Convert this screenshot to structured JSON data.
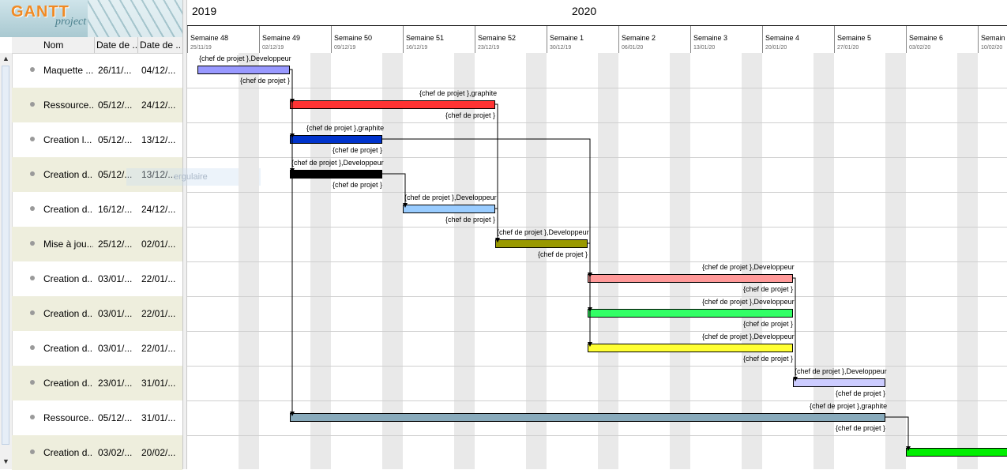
{
  "app": {
    "logo_main": "GANTT",
    "logo_sub": "project"
  },
  "columns": [
    "Nom",
    "Date de ...",
    "Date de ..."
  ],
  "tasks": [
    {
      "name": "Maquette ...",
      "start": "26/11/...",
      "end": "04/12/..."
    },
    {
      "name": "Ressource...",
      "start": "05/12/...",
      "end": "24/12/..."
    },
    {
      "name": "Creation l...",
      "start": "05/12/...",
      "end": "13/12/..."
    },
    {
      "name": "Creation d...",
      "start": "05/12/...",
      "end": "13/12/..."
    },
    {
      "name": "Creation d...",
      "start": "16/12/...",
      "end": "24/12/..."
    },
    {
      "name": "Mise à jou...",
      "start": "25/12/...",
      "end": "02/01/..."
    },
    {
      "name": "Creation d...",
      "start": "03/01/...",
      "end": "22/01/..."
    },
    {
      "name": "Creation d...",
      "start": "03/01/...",
      "end": "22/01/..."
    },
    {
      "name": "Creation d...",
      "start": "03/01/...",
      "end": "22/01/..."
    },
    {
      "name": "Creation d...",
      "start": "23/01/...",
      "end": "31/01/..."
    },
    {
      "name": "Ressource...",
      "start": "05/12/...",
      "end": "31/01/..."
    },
    {
      "name": "Creation d...",
      "start": "03/02/...",
      "end": "20/02/..."
    }
  ],
  "ghost_text": "ergulaire",
  "timeline": {
    "years": [
      "2019",
      "2020"
    ],
    "weeks": [
      {
        "label": "Semaine 48",
        "date": "25/11/19"
      },
      {
        "label": "Semaine 49",
        "date": "02/12/19"
      },
      {
        "label": "Semaine 50",
        "date": "09/12/19"
      },
      {
        "label": "Semaine 51",
        "date": "16/12/19"
      },
      {
        "label": "Semaine 52",
        "date": "23/12/19"
      },
      {
        "label": "Semaine 1",
        "date": "30/12/19"
      },
      {
        "label": "Semaine 2",
        "date": "06/01/20"
      },
      {
        "label": "Semaine 3",
        "date": "13/01/20"
      },
      {
        "label": "Semaine 4",
        "date": "20/01/20"
      },
      {
        "label": "Semaine 5",
        "date": "27/01/20"
      },
      {
        "label": "Semaine 6",
        "date": "03/02/20"
      },
      {
        "label": "Semain",
        "date": "10/02/20"
      }
    ]
  },
  "chart_data": {
    "type": "gantt",
    "bars": [
      {
        "start": "2019-11-26",
        "end": "2019-12-04",
        "color": "#9999ff",
        "top_label": "{chef de projet },Developpeur",
        "bottom_label": "{chef de projet }"
      },
      {
        "start": "2019-12-05",
        "end": "2019-12-24",
        "color": "#ff3333",
        "top_label": "{chef de projet },graphite",
        "bottom_label": "{chef de projet }"
      },
      {
        "start": "2019-12-05",
        "end": "2019-12-13",
        "color": "#0033cc",
        "top_label": "{chef de projet },graphite",
        "bottom_label": "{chef de projet }"
      },
      {
        "start": "2019-12-05",
        "end": "2019-12-13",
        "color": "#000000",
        "top_label": "{chef de projet },Developpeur",
        "bottom_label": "{chef de projet }"
      },
      {
        "start": "2019-12-16",
        "end": "2019-12-24",
        "color": "#99ccff",
        "top_label": "{chef de projet },Developpeur",
        "bottom_label": "{chef de projet }"
      },
      {
        "start": "2019-12-25",
        "end": "2020-01-02",
        "color": "#999900",
        "top_label": "{chef de projet },Developpeur",
        "bottom_label": "{chef de projet }"
      },
      {
        "start": "2020-01-03",
        "end": "2020-01-22",
        "color": "#ff9999",
        "top_label": "{chef de projet },Developpeur",
        "bottom_label": "{chef de projet }"
      },
      {
        "start": "2020-01-03",
        "end": "2020-01-22",
        "color": "#33ff66",
        "top_label": "{chef de projet },Developpeur",
        "bottom_label": "{chef de projet }"
      },
      {
        "start": "2020-01-03",
        "end": "2020-01-22",
        "color": "#ffff33",
        "top_label": "{chef de projet },Developpeur",
        "bottom_label": "{chef de projet }"
      },
      {
        "start": "2020-01-23",
        "end": "2020-01-31",
        "color": "#ccccff",
        "top_label": "{chef de projet },Developpeur",
        "bottom_label": "{chef de projet }"
      },
      {
        "start": "2019-12-05",
        "end": "2020-01-31",
        "color": "#88aabb",
        "top_label": "{chef de projet },graphite",
        "bottom_label": "{chef de projet }"
      },
      {
        "start": "2020-02-03",
        "end": "2020-02-20",
        "color": "#00ee00",
        "top_label": "",
        "bottom_label": ""
      }
    ],
    "dependencies": [
      [
        0,
        1
      ],
      [
        0,
        2
      ],
      [
        0,
        3
      ],
      [
        3,
        4
      ],
      [
        1,
        5
      ],
      [
        4,
        5
      ],
      [
        2,
        6
      ],
      [
        5,
        6
      ],
      [
        5,
        7
      ],
      [
        5,
        8
      ],
      [
        6,
        9
      ],
      [
        0,
        10
      ],
      [
        10,
        11
      ]
    ]
  }
}
